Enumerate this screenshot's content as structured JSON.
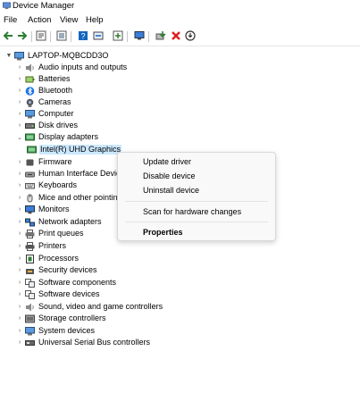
{
  "window": {
    "title": "Device Manager"
  },
  "menu": [
    "File",
    "Action",
    "View",
    "Help"
  ],
  "toolbar": {
    "icons": [
      "back-icon",
      "forward-icon",
      "properties-sheet-icon",
      "list-view-icon",
      "help-icon",
      "update-driver-icon",
      "monitor-icon",
      "scan-hardware-icon",
      "uninstall-icon",
      "disable-icon"
    ],
    "colors": {
      "accent_blue": "#1565c0",
      "danger_red": "#e11d1d",
      "green": "#2e7d32"
    }
  },
  "tree": {
    "root": "LAPTOP-MQBCDD3O",
    "items": [
      {
        "label": "Audio inputs and outputs",
        "icon": "speaker-icon",
        "expanded": false
      },
      {
        "label": "Batteries",
        "icon": "battery-icon",
        "expanded": false
      },
      {
        "label": "Bluetooth",
        "icon": "bluetooth-icon",
        "expanded": false
      },
      {
        "label": "Cameras",
        "icon": "camera-icon",
        "expanded": false
      },
      {
        "label": "Computer",
        "icon": "computer-icon",
        "expanded": false
      },
      {
        "label": "Disk drives",
        "icon": "disk-icon",
        "expanded": false
      },
      {
        "label": "Display adapters",
        "icon": "display-adapter-icon",
        "expanded": true
      },
      {
        "label": "Intel(R) UHD Graphics",
        "icon": "display-adapter-icon",
        "child": true,
        "selected": true
      },
      {
        "label": "Firmware",
        "icon": "chip-icon",
        "expanded": false
      },
      {
        "label": "Human Interface Devic",
        "icon": "hid-icon",
        "expanded": false
      },
      {
        "label": "Keyboards",
        "icon": "keyboard-icon",
        "expanded": false
      },
      {
        "label": "Mice and other pointin",
        "icon": "mouse-icon",
        "expanded": false
      },
      {
        "label": "Monitors",
        "icon": "monitor-icon",
        "expanded": false
      },
      {
        "label": "Network adapters",
        "icon": "network-icon",
        "expanded": false
      },
      {
        "label": "Print queues",
        "icon": "printer-icon",
        "expanded": false
      },
      {
        "label": "Printers",
        "icon": "printer-icon",
        "expanded": false
      },
      {
        "label": "Processors",
        "icon": "processor-icon",
        "expanded": false
      },
      {
        "label": "Security devices",
        "icon": "security-icon",
        "expanded": false
      },
      {
        "label": "Software components",
        "icon": "component-icon",
        "expanded": false
      },
      {
        "label": "Software devices",
        "icon": "component-icon",
        "expanded": false
      },
      {
        "label": "Sound, video and game controllers",
        "icon": "speaker-icon",
        "expanded": false
      },
      {
        "label": "Storage controllers",
        "icon": "storage-icon",
        "expanded": false
      },
      {
        "label": "System devices",
        "icon": "computer-icon",
        "expanded": false
      },
      {
        "label": "Universal Serial Bus controllers",
        "icon": "usb-icon",
        "expanded": false
      }
    ]
  },
  "context_menu": {
    "update": "Update driver",
    "disable": "Disable device",
    "uninstall": "Uninstall device",
    "scan": "Scan for hardware changes",
    "properties": "Properties"
  }
}
